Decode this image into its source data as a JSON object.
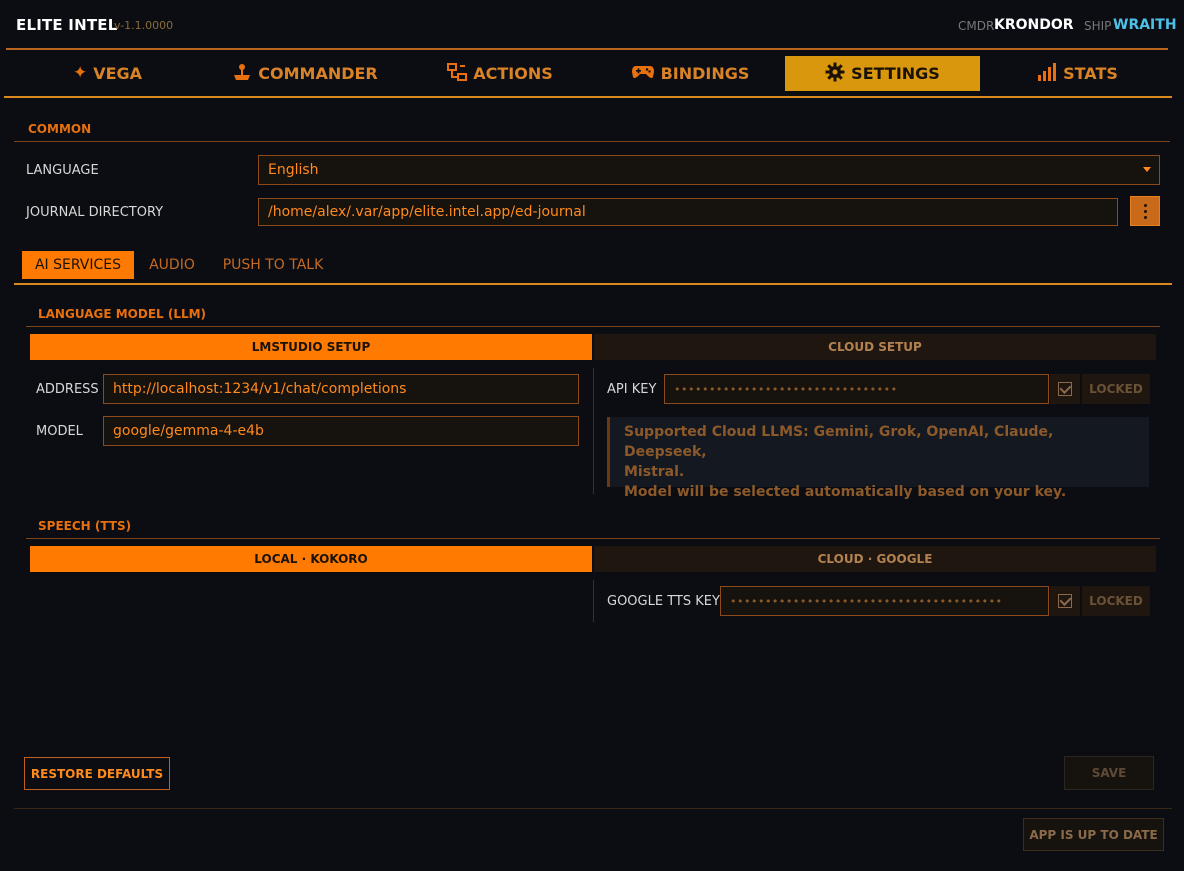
{
  "app": {
    "title": "ELITE INTEL",
    "version": "v-1.1.0000"
  },
  "status": {
    "cmdr_label": "CMDR",
    "cmdr": "KRONDOR",
    "ship_label": "SHIP",
    "ship": "WRAITH"
  },
  "colors": {
    "accent": "#ff7a00",
    "active_nav": "#d9970e",
    "ship": "#4ec0e8",
    "background": "#0b0d12"
  },
  "nav": [
    {
      "label": "VEGA",
      "icon": "sparkle-icon"
    },
    {
      "label": "COMMANDER",
      "icon": "joystick-icon"
    },
    {
      "label": "ACTIONS",
      "icon": "flow-icon"
    },
    {
      "label": "BINDINGS",
      "icon": "gamepad-icon"
    },
    {
      "label": "SETTINGS",
      "icon": "gear-icon",
      "active": true
    },
    {
      "label": "STATS",
      "icon": "bar-chart-icon"
    }
  ],
  "common": {
    "title": "COMMON",
    "language_label": "LANGUAGE",
    "language_value": "English",
    "journal_label": "JOURNAL DIRECTORY",
    "journal_value": "/home/alex/.var/app/elite.intel.app/ed-journal"
  },
  "tabs": [
    {
      "label": "AI SERVICES",
      "active": true
    },
    {
      "label": "AUDIO"
    },
    {
      "label": "PUSH TO TALK"
    }
  ],
  "llm": {
    "title": "LANGUAGE MODEL (LLM)",
    "local_tab": "LMSTUDIO SETUP",
    "cloud_tab": "CLOUD SETUP",
    "address_label": "ADDRESS",
    "address_value": "http://localhost:1234/v1/chat/completions",
    "model_label": "MODEL",
    "model_value": "google/gemma-4-e4b",
    "api_key_label": "API KEY",
    "api_key_mask": "••••••••••••••••••••••••••••••••",
    "locked_label": "LOCKED",
    "info_line1": "Supported Cloud LLMS: Gemini, Grok, OpenAI, Claude, Deepseek,",
    "info_line2": "Mistral.",
    "info_line3": "Model will be selected automatically based on your key."
  },
  "tts": {
    "title": "SPEECH (TTS)",
    "local_tab": "LOCAL · KOKORO",
    "cloud_tab": "CLOUD · GOOGLE",
    "key_label": "GOOGLE TTS KEY",
    "key_mask": "•••••••••••••••••••••••••••••••••••••••",
    "locked_label": "LOCKED"
  },
  "actions": {
    "restore": "RESTORE DEFAULTS",
    "save": "SAVE",
    "update_status": "APP IS UP TO DATE"
  }
}
